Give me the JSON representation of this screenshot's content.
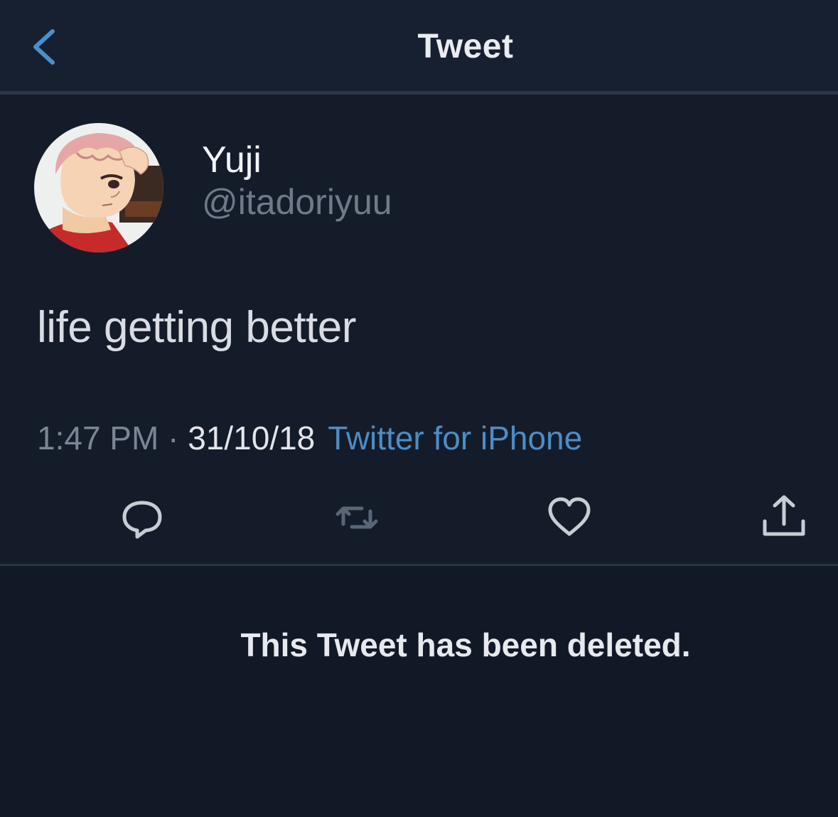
{
  "header": {
    "title": "Tweet",
    "back_icon": "chevron-left-icon"
  },
  "user": {
    "display_name": "Yuji",
    "handle": "@itadoriyuu",
    "avatar_icon": "anime-avatar"
  },
  "tweet": {
    "text": "life getting better",
    "time": "1:47 PM",
    "separator": " · ",
    "date": "31/10/18",
    "client": "Twitter for iPhone"
  },
  "actions": [
    {
      "name": "reply",
      "icon": "speech-bubble-icon"
    },
    {
      "name": "retweet",
      "icon": "retweet-icon"
    },
    {
      "name": "like",
      "icon": "heart-icon"
    },
    {
      "name": "share",
      "icon": "share-icon"
    }
  ],
  "deleted_notice": "This Tweet has been deleted.",
  "colors": {
    "background": "#151e2c",
    "accent": "#4d8dc5",
    "secondary_text": "#6f7a89"
  }
}
